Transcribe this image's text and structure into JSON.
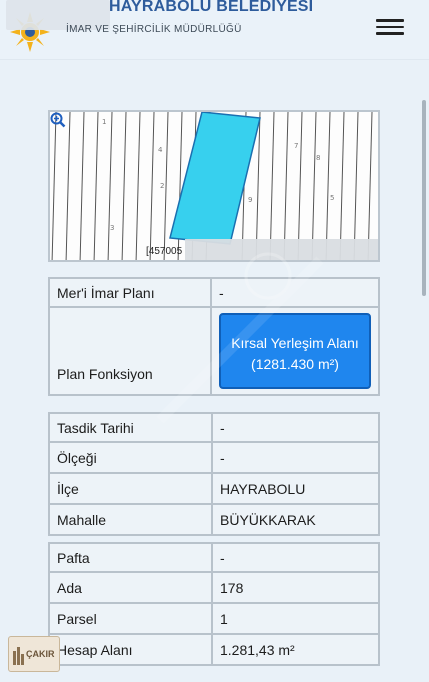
{
  "header": {
    "title": "HAYRABOLU BELEDİYESİ",
    "subtitle": "İMAR VE ŞEHİRCİLİK MÜDÜRLÜĞÜ",
    "menu_icon": "hamburger-menu-icon",
    "logo_icon": "sun-emblem-icon"
  },
  "map": {
    "coordinate_text": "[457005",
    "zoom_icon": "zoom-in-icon",
    "highlight_color": "#37d0ee"
  },
  "table1": {
    "rows": [
      {
        "label": "Mer'i İmar Planı",
        "value": "-"
      },
      {
        "label": "Plan Fonksiyon",
        "value": ""
      }
    ],
    "function_button": "Kırsal Yerleşim Alanı (1281.430 m²)"
  },
  "table2": {
    "rows": [
      {
        "label": "Tasdik Tarihi",
        "value": "-"
      },
      {
        "label": "Ölçeği",
        "value": "-"
      },
      {
        "label": "İlçe",
        "value": "HAYRABOLU"
      },
      {
        "label": "Mahalle",
        "value": "BÜYÜKKARAK"
      }
    ]
  },
  "table3": {
    "rows": [
      {
        "label": "Pafta",
        "value": "-"
      },
      {
        "label": "Ada",
        "value": "178"
      },
      {
        "label": "Parsel",
        "value": "1"
      },
      {
        "label": "Hesap Alanı",
        "value": "1.281,43 m²"
      }
    ]
  },
  "badge": {
    "text": "ÇAKIR"
  },
  "colors": {
    "accent": "#1f86ee",
    "title": "#2e5c9c",
    "background": "#e9f1f8"
  }
}
